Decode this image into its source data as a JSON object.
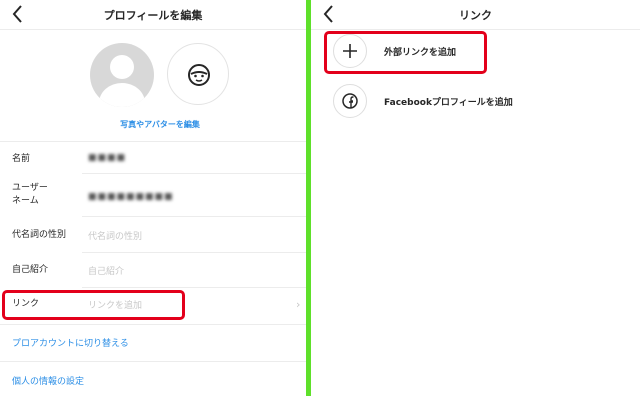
{
  "left": {
    "header": {
      "title": "プロフィールを編集"
    },
    "edit_photo": "写真やアバターを編集",
    "fields": [
      {
        "label": "名前",
        "value": "■■■■"
      },
      {
        "label": "ユーザー\nネーム",
        "value": "■■■■■■■■■"
      },
      {
        "label": "代名詞の性別",
        "placeholder": "代名詞の性別"
      },
      {
        "label": "自己紹介",
        "placeholder": "自己紹介"
      },
      {
        "label": "リンク",
        "placeholder": "リンクを追加"
      }
    ],
    "switch_pro": "プロアカウントに切り替える",
    "personal_info": "個人の情報の設定"
  },
  "right": {
    "header": {
      "title": "リンク"
    },
    "items": [
      {
        "label": "外部リンクを追加",
        "icon": "plus-icon"
      },
      {
        "label": "Facebookプロフィールを追加",
        "icon": "facebook-icon"
      }
    ]
  },
  "colors": {
    "accent_blue": "#2d8fe6",
    "highlight_red": "#e3001b",
    "divider_green": "#5ee02a"
  }
}
